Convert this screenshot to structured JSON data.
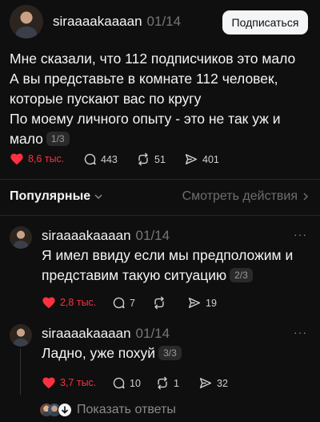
{
  "post": {
    "username": "siraaaakaaaan",
    "date": "01/14",
    "follow_label": "Подписаться",
    "text_lines": [
      "Мне сказали, что 112 подписчиков это мало",
      "А вы представьте в комнате 112 человек,",
      "которые пускают вас по кругу",
      "По моему личного опыту - это не так уж и",
      "мало"
    ],
    "page": "1/3",
    "likes": "8,6 тыс.",
    "comments": "443",
    "reposts": "51",
    "shares": "401"
  },
  "filter": {
    "sort_label": "Популярные",
    "activity_label": "Смотреть действия"
  },
  "replies": [
    {
      "username": "siraaaakaaaan",
      "date": "01/14",
      "text_lines": [
        "Я имел ввиду если мы предположим и",
        "представим такую ситуацию"
      ],
      "page": "2/3",
      "likes": "2,8 тыс.",
      "comments": "7",
      "reposts": "",
      "shares": "19"
    },
    {
      "username": "siraaaakaaaan",
      "date": "01/14",
      "text_lines": [
        "Ладно, уже похуй"
      ],
      "page": "3/3",
      "likes": "3,7 тыс.",
      "comments": "10",
      "reposts": "1",
      "shares": "32"
    }
  ],
  "show_replies_label": "Показать ответы",
  "colors": {
    "like": "#ff3040",
    "background": "#0f0f0f",
    "text": "#f3f5f7",
    "muted": "#777777"
  }
}
